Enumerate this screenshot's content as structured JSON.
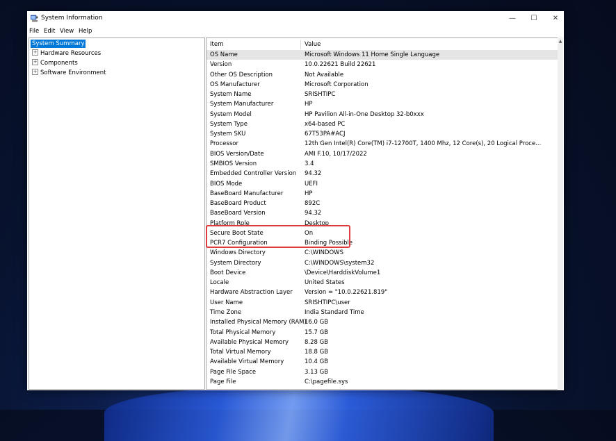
{
  "window": {
    "title": "System Information",
    "controls": {
      "minimize": "—",
      "maximize": "☐",
      "close": "✕"
    }
  },
  "menu": [
    "File",
    "Edit",
    "View",
    "Help"
  ],
  "tree": {
    "root": "System Summary",
    "items": [
      {
        "label": "Hardware Resources",
        "expander": "+"
      },
      {
        "label": "Components",
        "expander": "+"
      },
      {
        "label": "Software Environment",
        "expander": "+"
      }
    ]
  },
  "table": {
    "headers": {
      "item": "Item",
      "value": "Value"
    },
    "rows": [
      {
        "item": "OS Name",
        "value": "Microsoft Windows 11 Home Single Language"
      },
      {
        "item": "Version",
        "value": "10.0.22621 Build 22621"
      },
      {
        "item": "Other OS Description",
        "value": "Not Available"
      },
      {
        "item": "OS Manufacturer",
        "value": "Microsoft Corporation"
      },
      {
        "item": "System Name",
        "value": "SRISHTIPC"
      },
      {
        "item": "System Manufacturer",
        "value": "HP"
      },
      {
        "item": "System Model",
        "value": "HP Pavilion All-in-One Desktop 32-b0xxx"
      },
      {
        "item": "System Type",
        "value": "x64-based PC"
      },
      {
        "item": "System SKU",
        "value": "67T53PA#ACJ"
      },
      {
        "item": "Processor",
        "value": "12th Gen Intel(R) Core(TM) i7-12700T, 1400 Mhz, 12 Core(s), 20 Logical Proce..."
      },
      {
        "item": "BIOS Version/Date",
        "value": "AMI F.10, 10/17/2022"
      },
      {
        "item": "SMBIOS Version",
        "value": "3.4"
      },
      {
        "item": "Embedded Controller Version",
        "value": "94.32"
      },
      {
        "item": "BIOS Mode",
        "value": "UEFI"
      },
      {
        "item": "BaseBoard Manufacturer",
        "value": "HP"
      },
      {
        "item": "BaseBoard Product",
        "value": "892C"
      },
      {
        "item": "BaseBoard Version",
        "value": "94.32"
      },
      {
        "item": "Platform Role",
        "value": "Desktop"
      },
      {
        "item": "Secure Boot State",
        "value": "On"
      },
      {
        "item": "PCR7 Configuration",
        "value": "Binding Possible"
      },
      {
        "item": "Windows Directory",
        "value": "C:\\WINDOWS"
      },
      {
        "item": "System Directory",
        "value": "C:\\WINDOWS\\system32"
      },
      {
        "item": "Boot Device",
        "value": "\\Device\\HarddiskVolume1"
      },
      {
        "item": "Locale",
        "value": "United States"
      },
      {
        "item": "Hardware Abstraction Layer",
        "value": "Version = \"10.0.22621.819\""
      },
      {
        "item": "User Name",
        "value": "SRISHTIPC\\user"
      },
      {
        "item": "Time Zone",
        "value": "India Standard Time"
      },
      {
        "item": "Installed Physical Memory (RAM)",
        "value": "16.0 GB"
      },
      {
        "item": "Total Physical Memory",
        "value": "15.7 GB"
      },
      {
        "item": "Available Physical Memory",
        "value": "8.28 GB"
      },
      {
        "item": "Total Virtual Memory",
        "value": "18.8 GB"
      },
      {
        "item": "Available Virtual Memory",
        "value": "10.4 GB"
      },
      {
        "item": "Page File Space",
        "value": "3.13 GB"
      },
      {
        "item": "Page File",
        "value": "C:\\pagefile.sys"
      }
    ]
  },
  "colors": {
    "selection": "#0078d7",
    "highlight_box": "#e0393e",
    "row_selected": "#e5e5e5"
  },
  "icons": {
    "app": "system-information-icon",
    "scroll_up": "▲"
  }
}
